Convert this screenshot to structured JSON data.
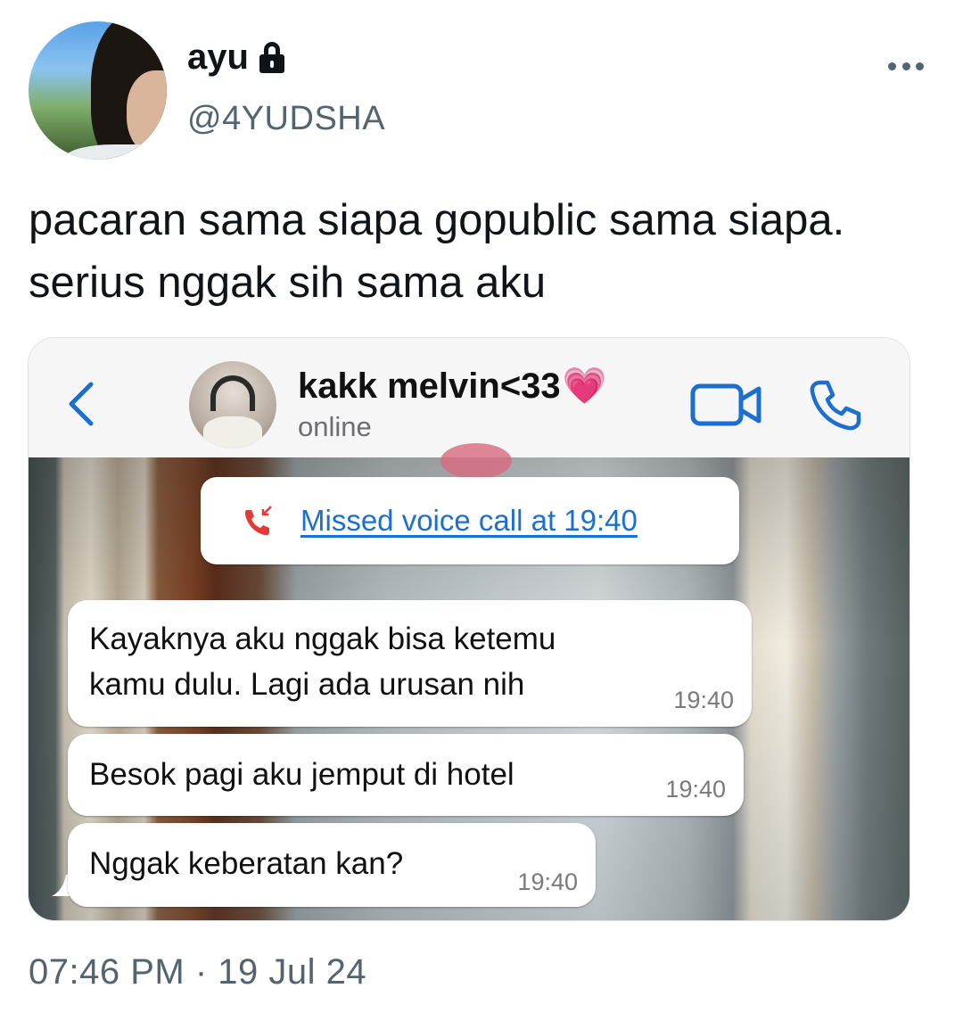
{
  "tweet": {
    "display_name": "ayu",
    "handle": "@4YUDSHA",
    "protected_icon": "lock-icon",
    "more_icon": "more-horizontal-icon",
    "text": "pacaran sama siapa gopublic sama siapa. serius nggak sih sama aku",
    "timestamp": "07:46 PM · 19 Jul 24"
  },
  "chat": {
    "contact_name": "kakk melvin<33",
    "contact_emoji": "💗",
    "contact_status": "online",
    "icons": [
      "back-chevron-icon",
      "video-call-icon",
      "phone-call-icon"
    ],
    "accent_color": "#1b6fd1",
    "missed_call": {
      "text": "Missed voice call at 19:40",
      "icon": "missed-call-icon",
      "icon_color": "#e53935"
    },
    "messages": [
      {
        "line1": "Kayaknya aku nggak bisa ketemu",
        "line2": "kamu dulu. Lagi ada urusan nih",
        "time": "19:40"
      },
      {
        "text": "Besok pagi aku jemput di hotel",
        "time": "19:40"
      },
      {
        "text": "Nggak keberatan kan?",
        "time": "19:40"
      }
    ]
  }
}
